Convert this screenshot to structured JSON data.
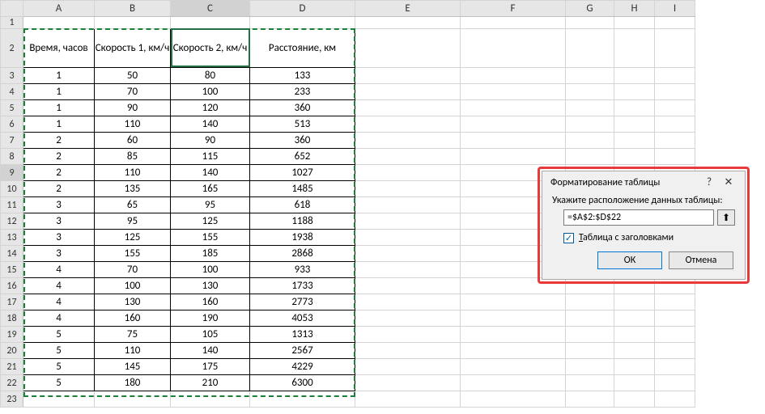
{
  "columns": [
    "A",
    "B",
    "C",
    "D",
    "E",
    "F",
    "G",
    "H",
    "I"
  ],
  "active_column": "C",
  "active_row": 9,
  "table": {
    "headers": [
      "Время, часов",
      "Скорость 1, км/ч",
      "Скорость 2, км/ч",
      "Расстояние, км"
    ],
    "rows": [
      [
        1,
        50,
        80,
        133
      ],
      [
        1,
        70,
        100,
        233
      ],
      [
        1,
        90,
        120,
        360
      ],
      [
        1,
        110,
        140,
        513
      ],
      [
        2,
        60,
        90,
        360
      ],
      [
        2,
        85,
        115,
        652
      ],
      [
        2,
        110,
        140,
        1027
      ],
      [
        2,
        135,
        165,
        1485
      ],
      [
        3,
        65,
        95,
        618
      ],
      [
        3,
        95,
        125,
        1188
      ],
      [
        3,
        125,
        155,
        1938
      ],
      [
        3,
        155,
        185,
        2868
      ],
      [
        4,
        70,
        100,
        933
      ],
      [
        4,
        100,
        130,
        1733
      ],
      [
        4,
        130,
        160,
        2773
      ],
      [
        4,
        160,
        190,
        4053
      ],
      [
        5,
        75,
        105,
        1313
      ],
      [
        5,
        110,
        140,
        2567
      ],
      [
        5,
        145,
        175,
        4229
      ],
      [
        5,
        180,
        210,
        6300
      ]
    ]
  },
  "dialog": {
    "title": "Форматирование таблицы",
    "help_label": "?",
    "close_label": "✕",
    "range_label": "Укажите расположение данных таблицы:",
    "range_value": "=$A$2:$D$22",
    "collapse_icon": "⬆",
    "checkbox_checked": true,
    "checkbox_label_pre": "Т",
    "checkbox_label_rest": "аблица с заголовками",
    "ok_label": "ОК",
    "cancel_label": "Отмена"
  }
}
